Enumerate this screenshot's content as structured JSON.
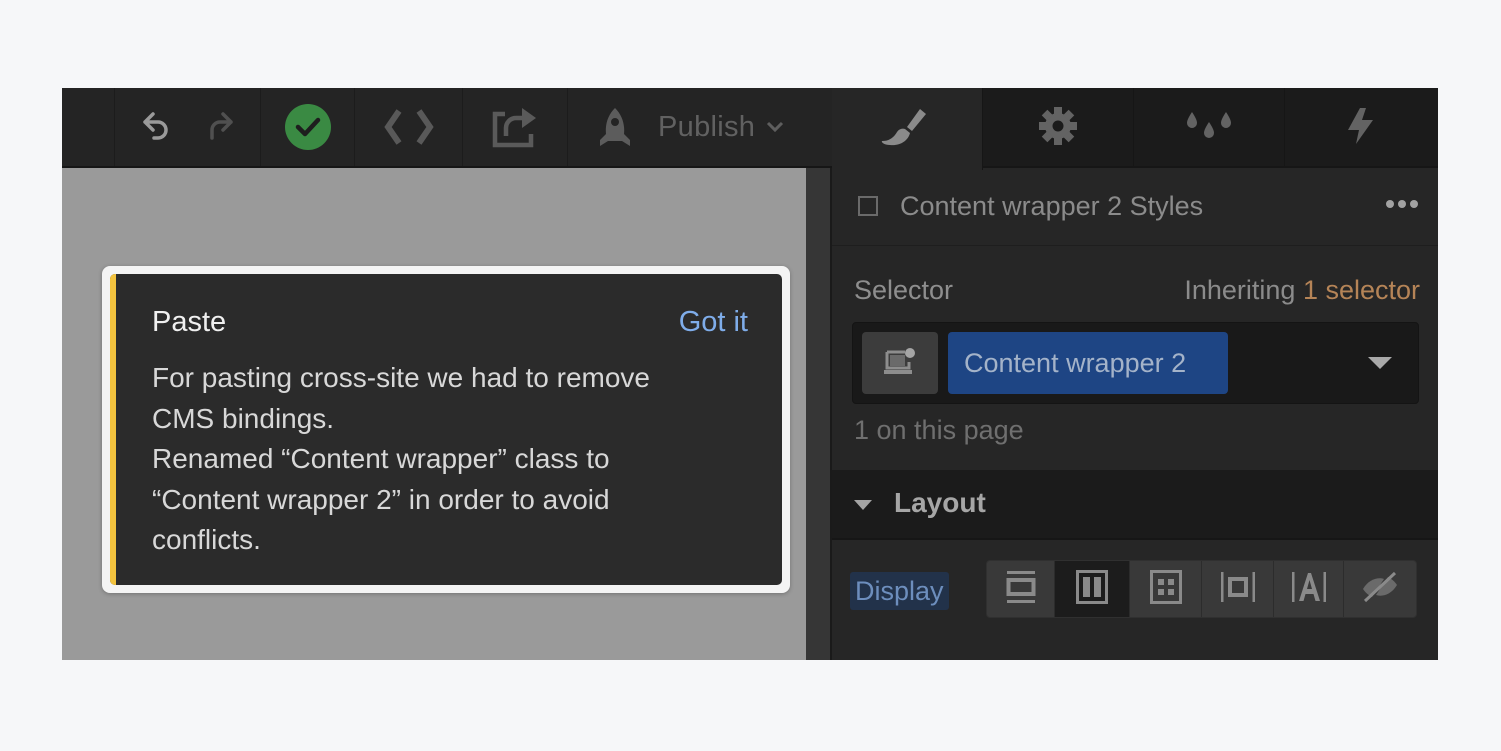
{
  "toolbar": {
    "undo_icon": "undo-icon",
    "redo_icon": "redo-icon",
    "status_icon": "check-circle-icon",
    "status_color": "#3a8a43",
    "code_icon": "code-brackets-icon",
    "export_icon": "export-share-icon",
    "publish_icon": "rocket-icon",
    "publish_label": "Publish",
    "publish_chevron_icon": "chevron-down-icon"
  },
  "toast": {
    "title": "Paste",
    "action_label": "Got it",
    "accent_color": "#f3c33e",
    "body_lines": [
      "For pasting cross-site we had to remove",
      "CMS bindings.",
      "Renamed “Content wrapper” class to",
      "“Content wrapper 2” in order to avoid",
      "conflicts."
    ]
  },
  "panel": {
    "tabs": [
      {
        "name": "style",
        "icon": "paintbrush-icon",
        "active": true
      },
      {
        "name": "settings",
        "icon": "gear-icon",
        "active": false
      },
      {
        "name": "style-manager",
        "icon": "droplets-icon",
        "active": false
      },
      {
        "name": "interactions",
        "icon": "lightning-icon",
        "active": false
      }
    ],
    "styles_title": "Content wrapper 2 Styles",
    "selector_label": "Selector",
    "inheriting_prefix": "Inheriting",
    "inheriting_count": "1 selector",
    "selector_chip": "Content wrapper 2",
    "on_page_text": "1 on this page",
    "layout_title": "Layout",
    "display_label": "Display",
    "display_options": [
      {
        "name": "block",
        "active": false
      },
      {
        "name": "flex",
        "active": true
      },
      {
        "name": "grid",
        "active": false
      },
      {
        "name": "inline-block",
        "active": false
      },
      {
        "name": "inline",
        "active": false
      },
      {
        "name": "none",
        "active": false
      }
    ]
  }
}
